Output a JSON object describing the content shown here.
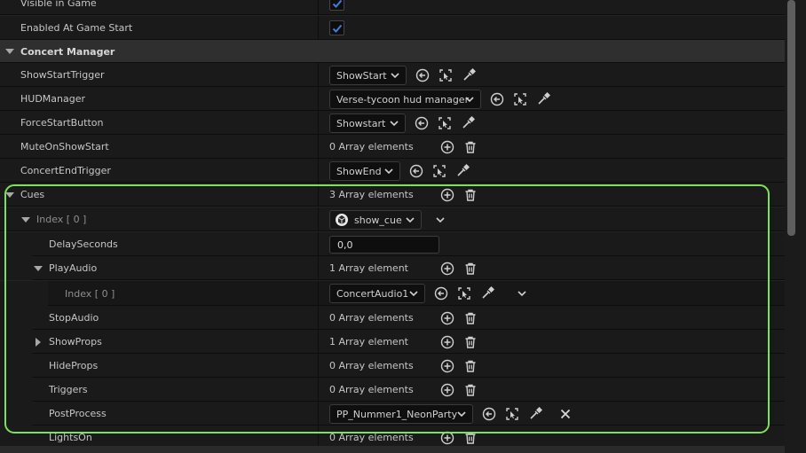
{
  "rows": {
    "visible_in_game": {
      "label": "Visible in Game"
    },
    "enabled_at_start": {
      "label": "Enabled At Game Start"
    },
    "category": {
      "label": "Concert Manager"
    },
    "show_start_trigger": {
      "label": "ShowStartTrigger",
      "value": "ShowStart"
    },
    "hud_manager": {
      "label": "HUDManager",
      "value": "Verse-tycoon hud manager"
    },
    "force_start_button": {
      "label": "ForceStartButton",
      "value": "Showstart"
    },
    "mute_on_show_start": {
      "label": "MuteOnShowStart",
      "value": "0 Array elements"
    },
    "concert_end_trigger": {
      "label": "ConcertEndTrigger",
      "value": "ShowEnd"
    },
    "cues": {
      "label": "Cues",
      "value": "3 Array elements"
    },
    "index0": {
      "label": "Index [ 0 ]",
      "value": "show_cue"
    },
    "delay_seconds": {
      "label": "DelaySeconds",
      "value": "0,0"
    },
    "play_audio": {
      "label": "PlayAudio",
      "value": "1 Array element"
    },
    "play_audio_index0": {
      "label": "Index [ 0 ]",
      "value": "ConcertAudio1"
    },
    "stop_audio": {
      "label": "StopAudio",
      "value": "0 Array elements"
    },
    "show_props": {
      "label": "ShowProps",
      "value": "1 Array element"
    },
    "hide_props": {
      "label": "HideProps",
      "value": "0 Array elements"
    },
    "triggers": {
      "label": "Triggers",
      "value": "0 Array elements"
    },
    "post_process": {
      "label": "PostProcess",
      "value": "PP_Nummer1_NeonParty"
    },
    "lights_on": {
      "label": "LightsOn",
      "value": "0 Array elements"
    }
  },
  "colors": {
    "highlight": "#7fe05a",
    "checkbox_check": "#3d7fd9",
    "panel_bg": "#242424"
  },
  "icons": [
    "back-arrow-icon",
    "browse-select-icon",
    "eyedropper-icon",
    "add-element-icon",
    "trash-icon",
    "chevron-down-icon",
    "clear-x-icon",
    "blueprint-class-icon"
  ]
}
